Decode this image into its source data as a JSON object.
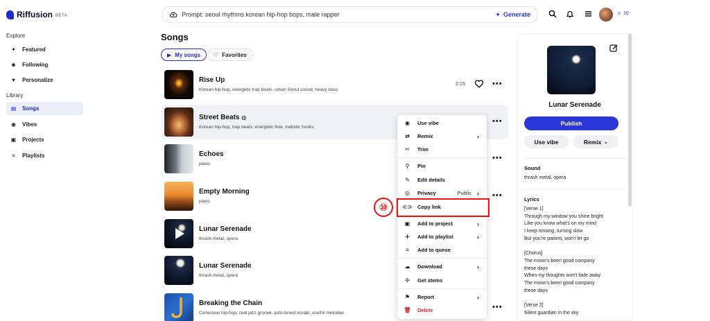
{
  "brand": {
    "name": "Riffusion",
    "badge": "BETA"
  },
  "sidebar": {
    "explore_label": "Explore",
    "library_label": "Library",
    "explore_items": [
      {
        "label": "Featured",
        "icon": "sparkle-icon"
      },
      {
        "label": "Following",
        "icon": "smile-icon"
      },
      {
        "label": "Personalize",
        "icon": "heart-icon"
      }
    ],
    "library_items": [
      {
        "label": "Songs",
        "icon": "music-stack-icon",
        "active": true
      },
      {
        "label": "Vibes",
        "icon": "vibe-icon"
      },
      {
        "label": "Projects",
        "icon": "folder-icon"
      },
      {
        "label": "Playlists",
        "icon": "playlist-icon"
      }
    ]
  },
  "topbar": {
    "prompt": "Prompt: seoul rhythms korean hip-hop bops, male rapper",
    "generate_label": "Generate",
    "credits": "10"
  },
  "songs": {
    "title": "Songs",
    "filters": {
      "my_songs": "My songs",
      "favorites": "Favorites"
    },
    "items": [
      {
        "title": "Rise Up",
        "desc": "Korean hip-hop, energetic trap beats, urban Seoul sound, heavy bass",
        "duration": "2:15"
      },
      {
        "title": "Street Beats",
        "desc": "Korean hip-hop, trap beats, energetic flow, melodic hooks",
        "duration": ""
      },
      {
        "title": "Echoes",
        "desc": "piano",
        "duration": ""
      },
      {
        "title": "Empty Morning",
        "desc": "piano",
        "duration": ""
      },
      {
        "title": "Lunar Serenade",
        "desc": "thrash metal, opera",
        "duration": ""
      },
      {
        "title": "Lunar Serenade",
        "desc": "thrash metal, opera",
        "duration": ""
      },
      {
        "title": "Breaking the Chain",
        "desc": "Conscious hip-hop, cool jazz groove, auto-tuned vocals, soulful melodies",
        "duration": ""
      }
    ]
  },
  "menu": {
    "use_vibe": "Use vibe",
    "remix": "Remix",
    "trim": "Trim",
    "pin": "Pin",
    "edit_details": "Edit details",
    "privacy": "Privacy",
    "privacy_value": "Public",
    "copy_link": "Copy link",
    "add_to_project": "Add to project",
    "add_to_playlist": "Add to playlist",
    "add_to_queue": "Add to queue",
    "download": "Download",
    "get_stems": "Get stems",
    "report": "Report",
    "delete": "Delete"
  },
  "annotation": {
    "number": "⑩"
  },
  "detail": {
    "title": "Lunar Serenade",
    "publish_label": "Publish",
    "use_vibe_label": "Use vibe",
    "remix_label": "Remix",
    "sound_heading": "Sound",
    "sound_value": "thrash metal, opera",
    "lyrics_heading": "Lyrics",
    "lyrics": [
      "[Verse 1]",
      "Through my window you shine bright",
      "Like you know what's on my mind",
      "I keep tossing, turning slow",
      "But you're patient, won't let go",
      "",
      "[Chorus]",
      "The moon's been good company",
      "these days",
      "When my thoughts won't fade away",
      "The moon's been good company",
      "these days",
      "",
      "[Verse 2]",
      "Silent guardian in the sky"
    ]
  }
}
